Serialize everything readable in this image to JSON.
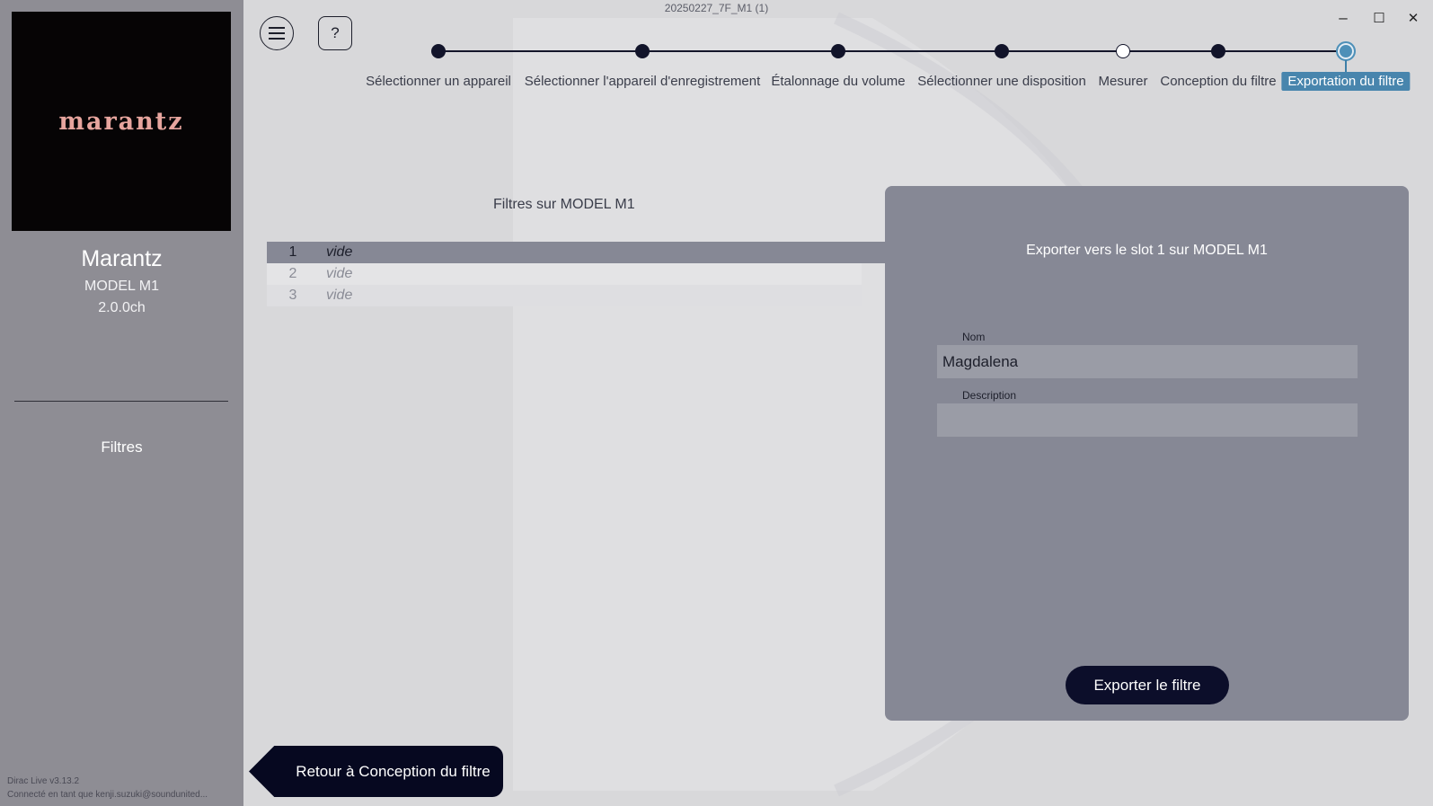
{
  "window": {
    "title": "20250227_7F_M1 (1)",
    "minimize": "–",
    "maximize": "☐",
    "close": "✕"
  },
  "sidebar": {
    "logo": "marantz",
    "brand": "Marantz",
    "model": "MODEL M1",
    "channels": "2.0.0ch",
    "nav_filters": "Filtres",
    "version": "Dirac Live v3.13.2",
    "connected": "Connecté en tant que kenji.suzuki@soundunited..."
  },
  "toolbar": {
    "help": "?"
  },
  "steps": [
    {
      "label": "Sélectionner un appareil",
      "state": "done"
    },
    {
      "label": "Sélectionner l'appareil d'enregistrement",
      "state": "done"
    },
    {
      "label": "Étalonnage du volume",
      "state": "done"
    },
    {
      "label": "Sélectionner une disposition",
      "state": "done"
    },
    {
      "label": "Mesurer",
      "state": "open"
    },
    {
      "label": "Conception du filtre",
      "state": "done"
    },
    {
      "label": "Exportation du filtre",
      "state": "current"
    }
  ],
  "filters": {
    "title": "Filtres sur MODEL M1",
    "slots": [
      {
        "num": "1",
        "name": "vide"
      },
      {
        "num": "2",
        "name": "vide"
      },
      {
        "num": "3",
        "name": "vide"
      }
    ]
  },
  "export": {
    "title": "Exporter vers le slot 1 sur MODEL M1",
    "name_label": "Nom",
    "name_value": "Magdalena",
    "description_label": "Description",
    "description_value": "",
    "button": "Exporter le filtre"
  },
  "back_button": "Retour à Conception du filtre",
  "colors": {
    "sidebar": "#8e8d94",
    "background": "#d8d8da",
    "panel": "#868895",
    "accent": "#4885ad",
    "dark": "#0c0e2a"
  }
}
